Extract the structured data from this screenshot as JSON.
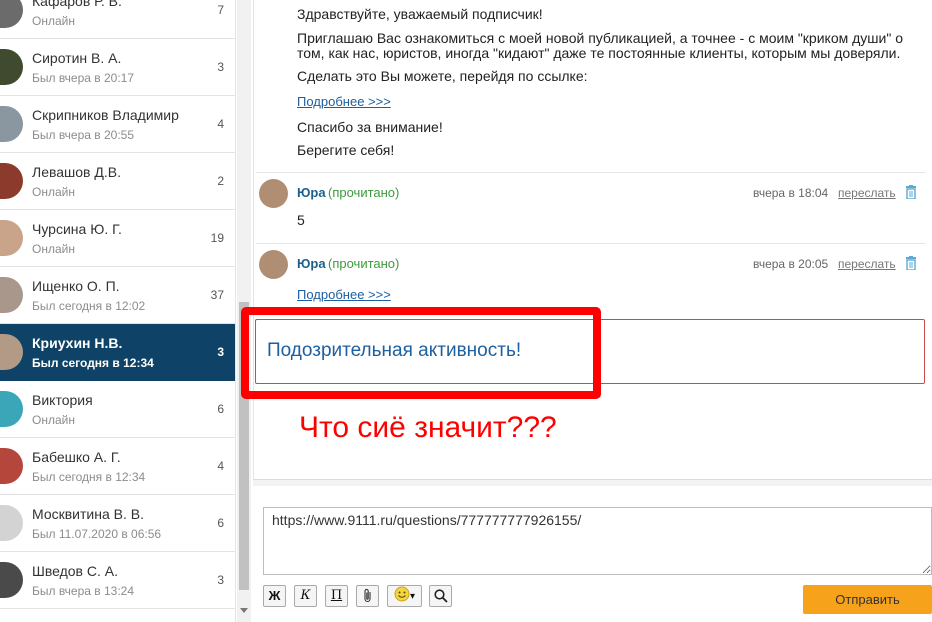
{
  "contacts": [
    {
      "name": "Кафаров Р. В.",
      "status": "Онлайн",
      "count": "7"
    },
    {
      "name": "Сиротин В. А.",
      "status": "Был вчера в 20:17",
      "count": "3"
    },
    {
      "name": "Скрипников Владимир",
      "status": "Был вчера в 20:55",
      "count": "4"
    },
    {
      "name": "Левашов Д.В.",
      "status": "Онлайн",
      "count": "2"
    },
    {
      "name": "Чурсина Ю. Г.",
      "status": "Онлайн",
      "count": "19"
    },
    {
      "name": "Ищенко О. П.",
      "status": "Был сегодня в 12:02",
      "count": "37"
    },
    {
      "name": "Криухин Н.В.",
      "status": "Был сегодня в 12:34",
      "count": "3",
      "active": true
    },
    {
      "name": "Виктория",
      "status": "Онлайн",
      "count": "6"
    },
    {
      "name": "Бабешко А. Г.",
      "status": "Был сегодня в 12:34",
      "count": "4"
    },
    {
      "name": "Москвитина В. В.",
      "status": "Был 11.07.2020 в 06:56",
      "count": "6"
    },
    {
      "name": "Шведов С. А.",
      "status": "Был вчера в 13:24",
      "count": "3"
    }
  ],
  "first_message": {
    "greeting": "Здравствуйте, уважаемый подписчик!",
    "line1": "Приглашаю Вас ознакомиться с моей новой публикацией, а точнее - с моим \"криком души\" о",
    "line2": "том, как нас, юристов, иногда \"кидают\" даже те постоянные клиенты, которым мы доверяли.",
    "line3": "Сделать это Вы можете, перейдя по ссылке:",
    "link": "Подробнее >>>",
    "thanks": "Спасибо за внимание!",
    "bye": "Берегите себя!"
  },
  "messages": [
    {
      "sender": "Юра",
      "read": "(прочитано)",
      "time": "вчера в 18:04",
      "forward": "переслать",
      "text": "5"
    },
    {
      "sender": "Юра",
      "read": "(прочитано)",
      "time": "вчера в 20:05",
      "forward": "переслать",
      "link": "Подробнее >>>"
    }
  ],
  "alert": {
    "text": "Подозрительная активность!"
  },
  "annotation": "Что сиё значит???",
  "composer": {
    "value": "https://www.9111.ru/questions/777777777926155/"
  },
  "toolbar": {
    "bold": "Ж",
    "italic": "К",
    "underline": "П",
    "emoji_caret": "▾"
  },
  "send_label": "Отправить",
  "colors": {
    "active_contact": "#0e4266",
    "send_button": "#f7a21b",
    "annotation": "#ff0000",
    "read_status": "#3c9a3c"
  },
  "icons": {
    "delete": "trash-icon",
    "attach": "paperclip-icon",
    "emoji": "smiley-icon",
    "search": "magnifier-icon"
  }
}
